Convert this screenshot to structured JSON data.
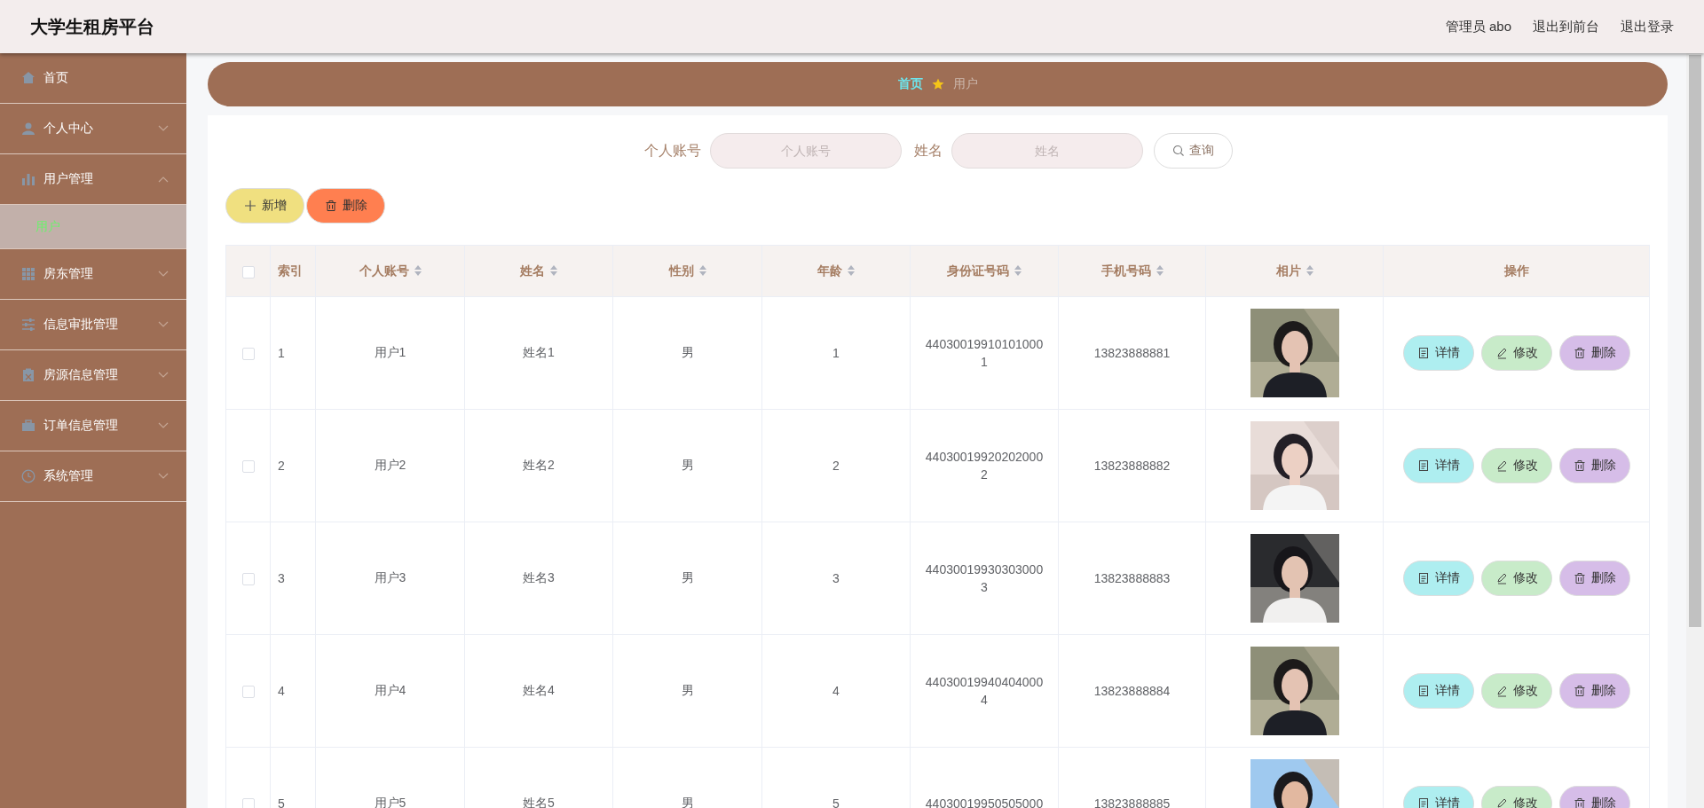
{
  "app": {
    "title": "大学生租房平台"
  },
  "header_links": [
    {
      "text": "管理员 abo"
    },
    {
      "text": "退出到前台"
    },
    {
      "text": "退出登录"
    }
  ],
  "sidebar": {
    "items": [
      {
        "kind": "link",
        "label": "首页"
      },
      {
        "kind": "menu",
        "label": "个人中心",
        "expanded": false
      },
      {
        "kind": "menu",
        "label": "用户管理",
        "expanded": true,
        "children": [
          {
            "label": "用户",
            "selected": true
          }
        ]
      },
      {
        "kind": "menu",
        "label": "房东管理",
        "expanded": false
      },
      {
        "kind": "menu",
        "label": "信息审批管理",
        "expanded": false
      },
      {
        "kind": "menu",
        "label": "房源信息管理",
        "expanded": false
      },
      {
        "kind": "menu",
        "label": "订单信息管理",
        "expanded": false
      },
      {
        "kind": "menu",
        "label": "系统管理",
        "expanded": false
      }
    ]
  },
  "breadcrumb": [
    {
      "text": "首页",
      "selected": false
    },
    {
      "text": "用户",
      "selected": true
    }
  ],
  "search": {
    "fields": [
      {
        "label": "个人账号",
        "placeholder": "个人账号"
      },
      {
        "label": "姓名",
        "placeholder": "姓名"
      }
    ],
    "button": "查询"
  },
  "toolbar": [
    {
      "kind": "add",
      "label": "新增"
    },
    {
      "kind": "delete",
      "label": "删除"
    }
  ],
  "table": {
    "select_all": {
      "checked": false
    },
    "columns": [
      {
        "label": "索引",
        "sortable": false
      },
      {
        "label": "个人账号",
        "sortable": true
      },
      {
        "label": "姓名",
        "sortable": true
      },
      {
        "label": "性别",
        "sortable": true
      },
      {
        "label": "年龄",
        "sortable": true
      },
      {
        "label": "身份证号码",
        "sortable": true
      },
      {
        "label": "手机号码",
        "sortable": true
      },
      {
        "label": "相片",
        "sortable": true
      },
      {
        "label": "操作",
        "sortable": false
      }
    ],
    "rows": [
      {
        "checked": false,
        "index": "1",
        "account": "用户1",
        "name": "姓名1",
        "gender": "男",
        "age": "1",
        "id_number": "440300199101010001",
        "phone": "13823888881",
        "actions": [
          {
            "kind": "detail",
            "label": "详情"
          },
          {
            "kind": "edit",
            "label": "修改"
          },
          {
            "kind": "delete",
            "label": "删除"
          }
        ]
      },
      {
        "checked": false,
        "index": "2",
        "account": "用户2",
        "name": "姓名2",
        "gender": "男",
        "age": "2",
        "id_number": "440300199202020002",
        "phone": "13823888882",
        "actions": [
          {
            "kind": "detail",
            "label": "详情"
          },
          {
            "kind": "edit",
            "label": "修改"
          },
          {
            "kind": "delete",
            "label": "删除"
          }
        ]
      },
      {
        "checked": false,
        "index": "3",
        "account": "用户3",
        "name": "姓名3",
        "gender": "男",
        "age": "3",
        "id_number": "440300199303030003",
        "phone": "13823888883",
        "actions": [
          {
            "kind": "detail",
            "label": "详情"
          },
          {
            "kind": "edit",
            "label": "修改"
          },
          {
            "kind": "delete",
            "label": "删除"
          }
        ]
      },
      {
        "checked": false,
        "index": "4",
        "account": "用户4",
        "name": "姓名4",
        "gender": "男",
        "age": "4",
        "id_number": "440300199404040004",
        "phone": "13823888884",
        "actions": [
          {
            "kind": "detail",
            "label": "详情"
          },
          {
            "kind": "edit",
            "label": "修改"
          },
          {
            "kind": "delete",
            "label": "删除"
          }
        ]
      },
      {
        "checked": false,
        "index": "5",
        "account": "用户5",
        "name": "姓名5",
        "gender": "男",
        "age": "5",
        "id_number": "44030019950505000",
        "phone": "13823888885",
        "actions": [
          {
            "kind": "detail",
            "label": "详情"
          },
          {
            "kind": "edit",
            "label": "修改"
          },
          {
            "kind": "delete",
            "label": "删除"
          }
        ]
      }
    ]
  }
}
